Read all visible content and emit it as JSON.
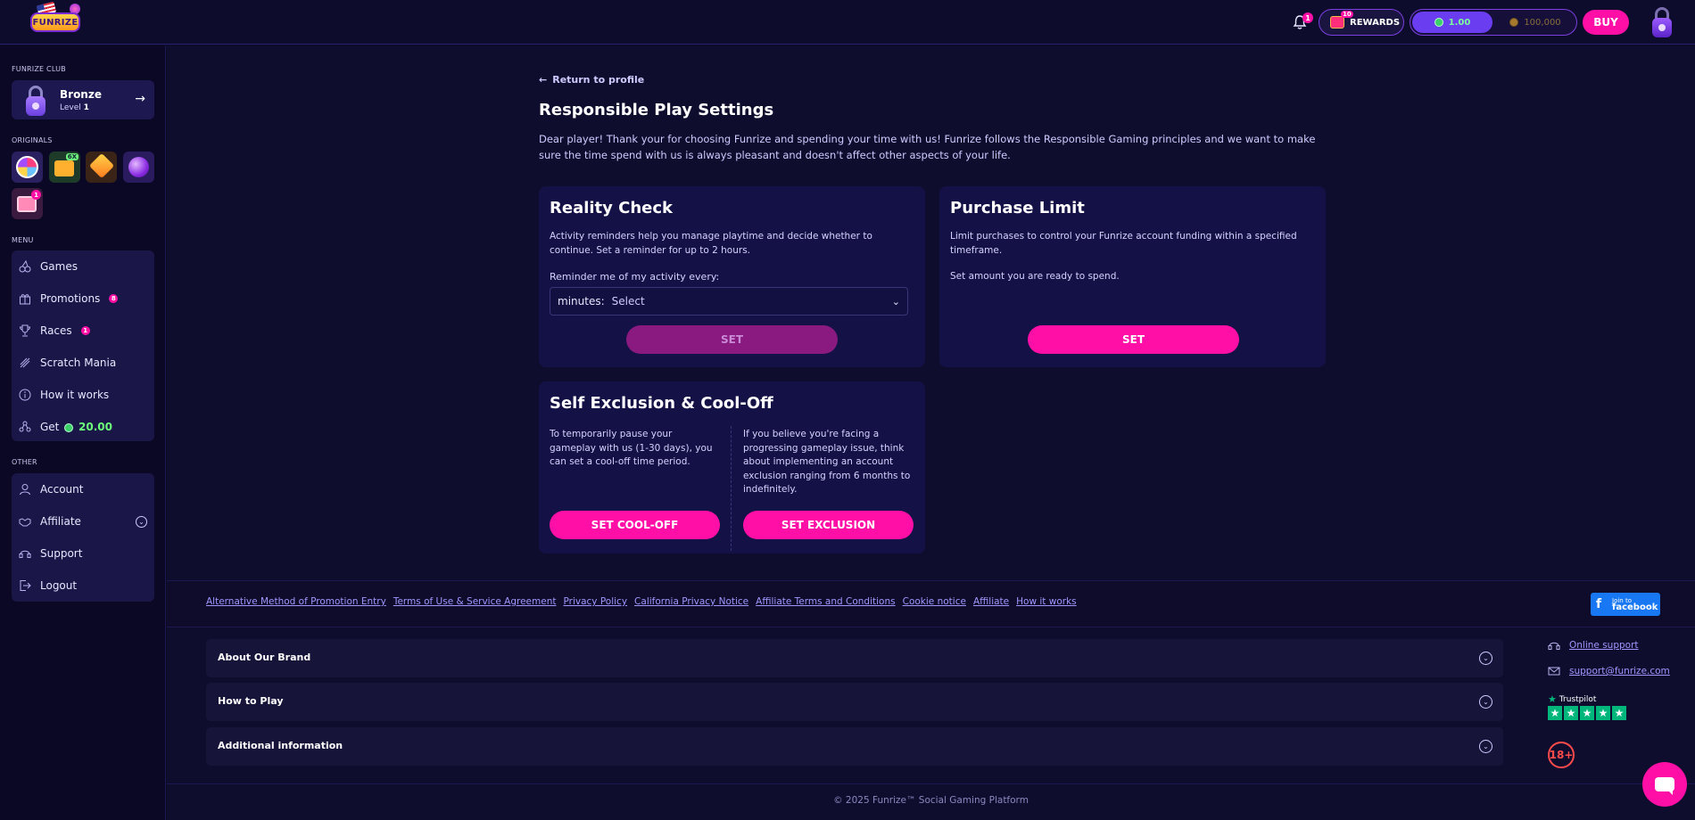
{
  "header": {
    "logo_text": "FUNRIZE",
    "notification_count": "1",
    "rewards": {
      "label": "REWARDS",
      "count": "10"
    },
    "balance": {
      "coins": "1.00",
      "tournament_coins": "100,000"
    },
    "buy_label": "BUY"
  },
  "sidebar": {
    "club": {
      "section_title": "FUNRIZE CLUB",
      "name": "Bronze",
      "level_label": "Level",
      "level_value": "1"
    },
    "originals": {
      "section_title": "ORIGINALS",
      "badge_tag": "6X",
      "notification_count": "1"
    },
    "menu": {
      "section_title": "MENU",
      "items": [
        {
          "label": "Games",
          "icon": "cherries-icon"
        },
        {
          "label": "Promotions",
          "icon": "gift-icon",
          "badge": "8"
        },
        {
          "label": "Races",
          "icon": "trophy-icon",
          "badge": "1"
        },
        {
          "label": "Scratch Mania",
          "icon": "scratch-icon"
        },
        {
          "label": "How it works",
          "icon": "info-icon"
        },
        {
          "label": "Get",
          "icon": "share-icon",
          "amount": "20.00"
        }
      ]
    },
    "other": {
      "section_title": "OTHER",
      "items": [
        {
          "label": "Account",
          "icon": "user-icon"
        },
        {
          "label": "Affiliate",
          "icon": "handshake-icon"
        },
        {
          "label": "Support",
          "icon": "headset-icon"
        },
        {
          "label": "Logout",
          "icon": "logout-icon"
        }
      ]
    }
  },
  "main": {
    "back_label": "Return to profile",
    "title": "Responsible Play Settings",
    "intro": "Dear player! Thank your for choosing Funrize and spending your time with us! Funrize follows the Responsible Gaming principles and we want to make sure the time spend with us is always pleasant and doesn't affect other aspects of your life.",
    "reality_check": {
      "title": "Reality Check",
      "text": "Activity reminders help you manage playtime and decide whether to continue. Set a reminder for up to 2 hours.",
      "field_label": "Reminder me of my activity every:",
      "select_label": "minutes:",
      "select_value": "Select",
      "button": "SET"
    },
    "purchase_limit": {
      "title": "Purchase Limit",
      "text": "Limit purchases to control your Funrize account funding within a specified timeframe.",
      "subtext": "Set amount you are ready to spend.",
      "button": "SET"
    },
    "self_exclusion": {
      "title": "Self Exclusion & Cool-Off",
      "cooloff_text": "To temporarily pause your gameplay with us (1-30 days), you can set a cool-off time period.",
      "exclusion_text": "If you believe you're facing a progressing gameplay issue, think about implementing an account exclusion ranging from 6 months to indefinitely.",
      "cooloff_button": "SET COOL-OFF",
      "exclusion_button": "SET EXCLUSION"
    }
  },
  "footer": {
    "links": [
      "Alternative Method of Promotion Entry",
      "Terms of Use & Service Agreement",
      "Privacy Policy",
      "California Privacy Notice",
      "Affiliate Terms and Conditions",
      "Cookie notice",
      "Affiliate",
      "How it works"
    ],
    "facebook": {
      "small": "Join to",
      "big": "facebook"
    },
    "accordions": [
      "About Our Brand",
      "How to Play",
      "Additional information"
    ],
    "online_support": "Online support",
    "email": "support@funrize.com",
    "trustpilot": "Trustpilot",
    "age": "18+",
    "copyright": "© 2025 Funrize™ Social Gaming Platform"
  },
  "colors": {
    "accent_pink": "#ff0fa6",
    "accent_purple": "#6b3df0",
    "background": "#0f0d2e",
    "card": "#141146"
  }
}
